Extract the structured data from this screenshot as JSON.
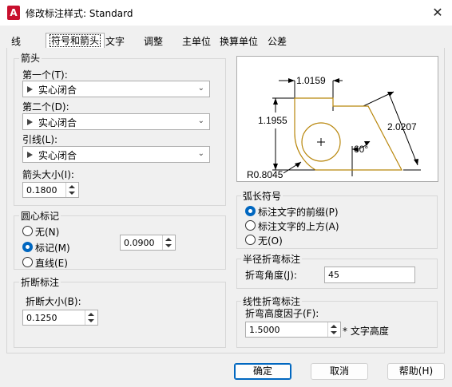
{
  "window": {
    "title": "修改标注样式: Standard",
    "app_icon": "A"
  },
  "tabs": [
    "线",
    "符号和箭头",
    "文字",
    "调整",
    "主单位",
    "换算单位",
    "公差"
  ],
  "arrowheads": {
    "title": "箭头",
    "first_label": "第一个(T):",
    "first_value": "实心闭合",
    "second_label": "第二个(D):",
    "second_value": "实心闭合",
    "leader_label": "引线(L):",
    "leader_value": "实心闭合",
    "size_label": "箭头大小(I):",
    "size_value": "0.1800"
  },
  "center_marks": {
    "title": "圆心标记",
    "options": [
      "无(N)",
      "标记(M)",
      "直线(E)"
    ],
    "selected": "标记(M)",
    "size_value": "0.0900"
  },
  "dim_break": {
    "title": "折断标注",
    "size_label": "折断大小(B):",
    "size_value": "0.1250"
  },
  "preview": {
    "dim_top": "1.0159",
    "dim_left": "1.1955",
    "dim_right": "2.0207",
    "angle": "60°",
    "radius": "R0.8045"
  },
  "arc_length": {
    "title": "弧长符号",
    "options": [
      "标注文字的前缀(P)",
      "标注文字的上方(A)",
      "无(O)"
    ],
    "selected": "标注文字的前缀(P)"
  },
  "radius_jog": {
    "title": "半径折弯标注",
    "angle_label": "折弯角度(J):",
    "angle_value": "45"
  },
  "linear_jog": {
    "title": "线性折弯标注",
    "height_label": "折弯高度因子(F):",
    "height_value": "1.5000",
    "suffix": "* 文字高度"
  },
  "buttons": {
    "ok": "确定",
    "cancel": "取消",
    "help": "帮助(H)"
  },
  "colors": {
    "accent": "#0067c0",
    "preview_shape": "#b8860b",
    "app_icon": "#c8102e"
  }
}
